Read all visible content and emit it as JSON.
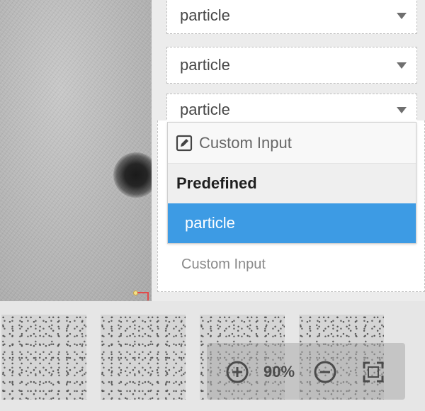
{
  "selects": [
    {
      "value": "particle"
    },
    {
      "value": "particle"
    },
    {
      "value": "particle"
    }
  ],
  "dropdown": {
    "custom_input_label": "Custom Input",
    "group_label": "Predefined",
    "options": [
      {
        "label": "particle",
        "selected": true
      }
    ]
  },
  "custom_input_placeholder": "Custom Input",
  "zoom": {
    "level": "90%"
  },
  "colors": {
    "selected_option": "#3d9be4",
    "accent_annotation": "#e24a4a"
  }
}
